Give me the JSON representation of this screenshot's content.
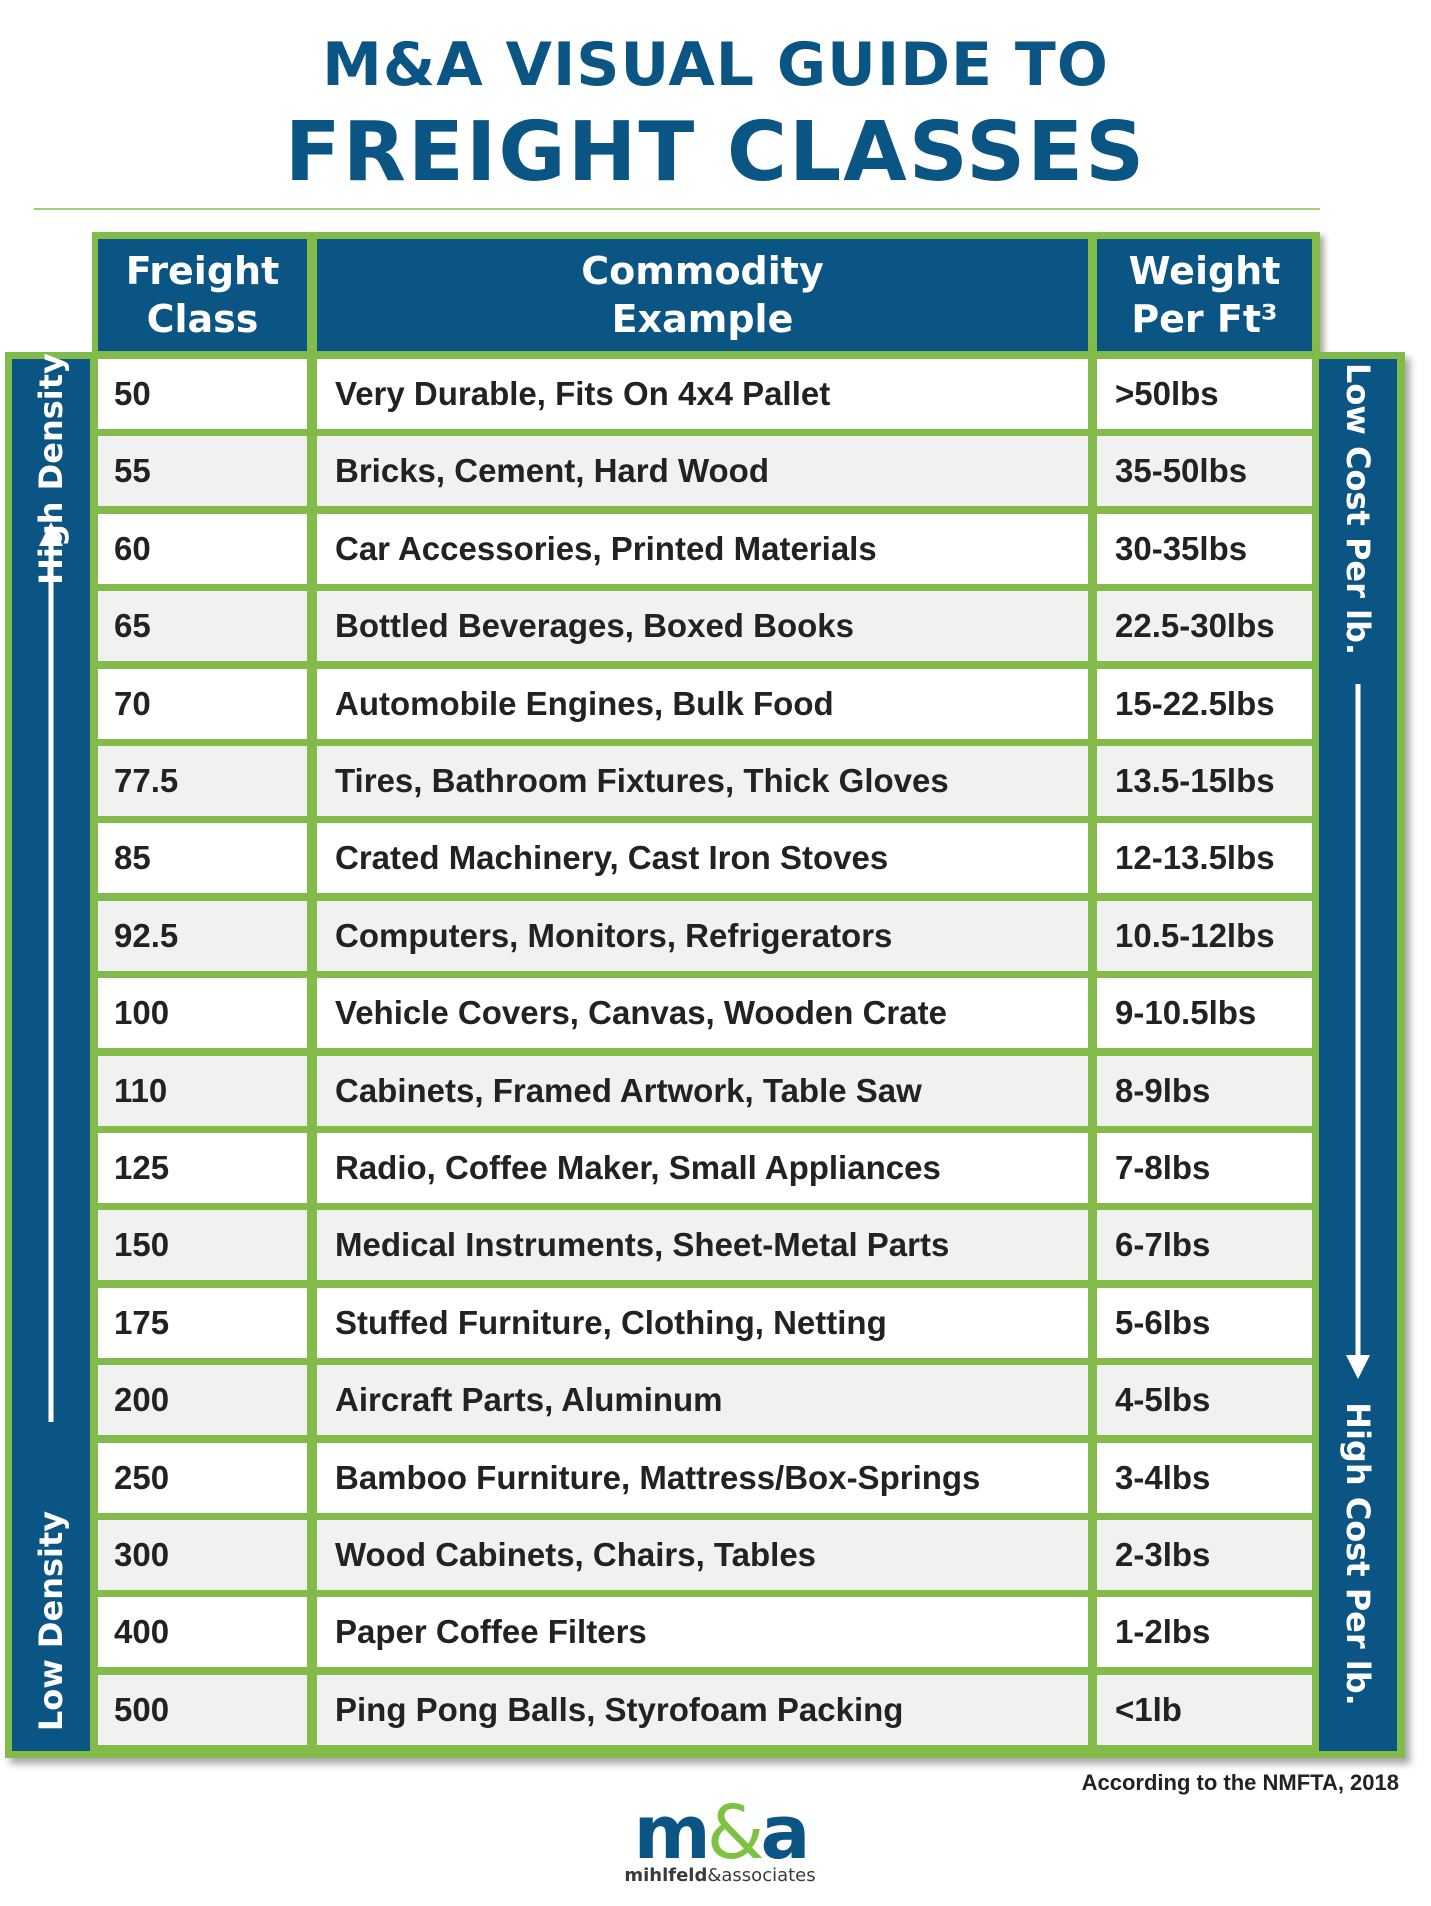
{
  "title": {
    "line1": "M&A VISUAL GUIDE TO",
    "line2": "FREIGHT CLASSES"
  },
  "table": {
    "headers": [
      {
        "line1": "Freight",
        "line2": "Class"
      },
      {
        "line1": "Commodity",
        "line2": "Example"
      },
      {
        "line1": "Weight",
        "line2": "Per Ft³"
      }
    ],
    "rows": [
      {
        "class": "50",
        "example": "Very Durable, Fits On 4x4 Pallet",
        "weight": ">50lbs"
      },
      {
        "class": "55",
        "example": "Bricks, Cement, Hard Wood",
        "weight": "35-50lbs"
      },
      {
        "class": "60",
        "example": "Car Accessories, Printed Materials",
        "weight": "30-35lbs"
      },
      {
        "class": "65",
        "example": "Bottled Beverages, Boxed Books",
        "weight": "22.5-30lbs"
      },
      {
        "class": "70",
        "example": "Automobile Engines, Bulk Food",
        "weight": "15-22.5lbs"
      },
      {
        "class": "77.5",
        "example": "Tires, Bathroom Fixtures, Thick Gloves",
        "weight": "13.5-15lbs"
      },
      {
        "class": "85",
        "example": "Crated Machinery, Cast Iron Stoves",
        "weight": "12-13.5lbs"
      },
      {
        "class": "92.5",
        "example": "Computers, Monitors, Refrigerators",
        "weight": "10.5-12lbs"
      },
      {
        "class": "100",
        "example": "Vehicle Covers, Canvas, Wooden Crate",
        "weight": "9-10.5lbs"
      },
      {
        "class": "110",
        "example": "Cabinets, Framed Artwork, Table Saw",
        "weight": "8-9lbs"
      },
      {
        "class": "125",
        "example": "Radio, Coffee Maker, Small Appliances",
        "weight": "7-8lbs"
      },
      {
        "class": "150",
        "example": "Medical Instruments, Sheet-Metal Parts",
        "weight": "6-7lbs"
      },
      {
        "class": "175",
        "example": "Stuffed Furniture, Clothing, Netting",
        "weight": "5-6lbs"
      },
      {
        "class": "200",
        "example": "Aircraft Parts, Aluminum",
        "weight": "4-5lbs"
      },
      {
        "class": "250",
        "example": "Bamboo Furniture, Mattress/Box-Springs",
        "weight": "3-4lbs"
      },
      {
        "class": "300",
        "example": "Wood Cabinets, Chairs, Tables",
        "weight": "2-3lbs"
      },
      {
        "class": "400",
        "example": "Paper Coffee Filters",
        "weight": "1-2lbs"
      },
      {
        "class": "500",
        "example": "Ping Pong Balls, Styrofoam Packing",
        "weight": "<1lb"
      }
    ]
  },
  "side_labels": {
    "left_top": "High Density",
    "left_bottom": "Low Density",
    "right_top": "Low Cost Per lb.",
    "right_bottom": "High Cost Per lb."
  },
  "icons": {
    "left_arrow": "arrow-up-icon",
    "right_arrow": "arrow-down-icon"
  },
  "source_note": "According to the NMFTA, 2018",
  "logo": {
    "m": "m",
    "amp": "&",
    "a": "a",
    "sub_bold": "mihlfeld",
    "sub_rest": "&associates"
  },
  "colors": {
    "brand_blue": "#0b5585",
    "accent_green": "#83bb4b",
    "text_dark": "#222222",
    "row_alt": "#f1f1f1"
  }
}
